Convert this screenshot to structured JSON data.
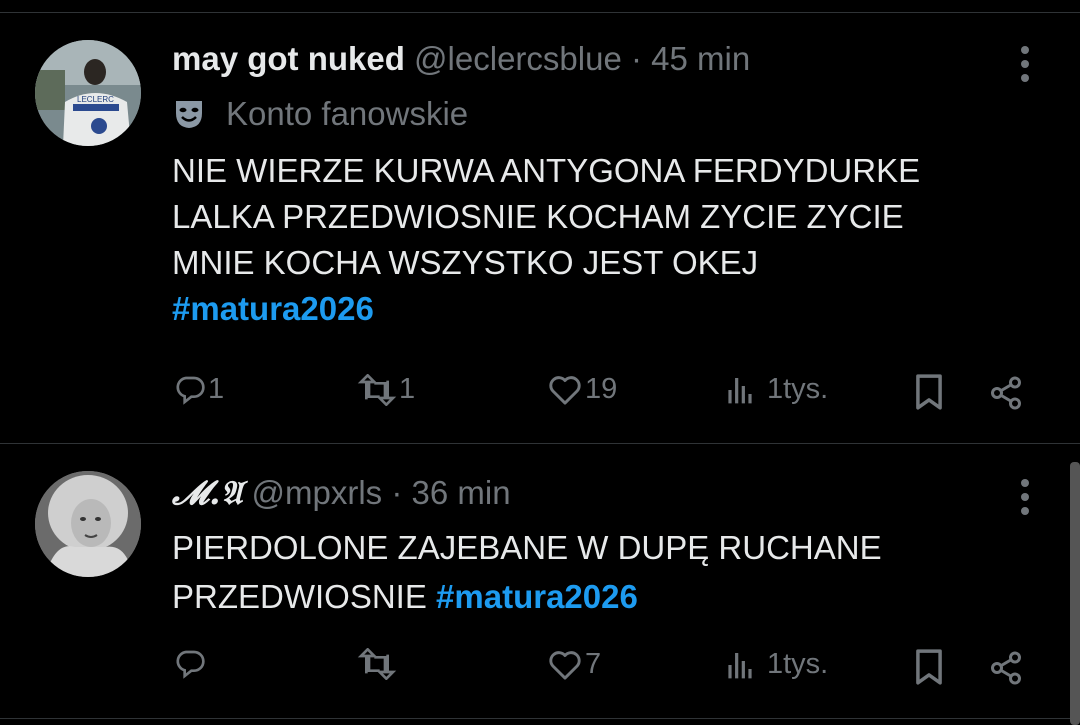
{
  "tweets": [
    {
      "name": "may got nuked",
      "handle": "@leclercsblue",
      "time": "· 45 min",
      "fan_label": "Konto fanowskie",
      "icons": {
        "avatar": "avatar-photo",
        "fan": "theater-mask-icon",
        "more": "more-vertical-icon"
      },
      "text_lines": [
        "NIE WIERZE KURWA ANTYGONA FERDYDURKE",
        "LALKA PRZEDWIOSNIE KOCHAM ZYCIE ZYCIE",
        "MNIE KOCHA WSZYSTKO JEST OKEJ"
      ],
      "hashtag": "#matura2026",
      "actions": {
        "replies": "1",
        "reposts": "1",
        "likes": "19",
        "views": "1tys."
      },
      "avatar_text": "LECLERC"
    },
    {
      "name": "𝓜.𝔄",
      "handle": "@mpxrls",
      "time": "· 36 min",
      "icons": {
        "avatar": "avatar-photo",
        "more": "more-vertical-icon"
      },
      "text_lines": [
        "PIERDOLONE ZAJEBANE W DUPĘ RUCHANE",
        "PRZEDWIOSNIE"
      ],
      "hashtag": "#matura2026",
      "actions": {
        "replies": "",
        "reposts": "",
        "likes": "7",
        "views": "1tys."
      }
    }
  ],
  "colors": {
    "background": "#000000",
    "text": "#e7e9ea",
    "muted": "#71767b",
    "link": "#1d9bf0"
  }
}
